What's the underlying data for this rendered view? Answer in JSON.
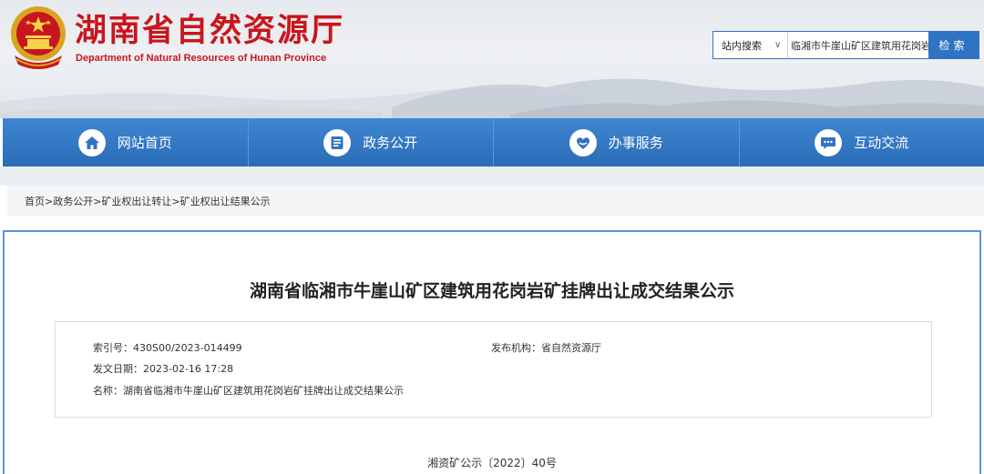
{
  "header": {
    "title": "湖南省自然资源厅",
    "subtitle": "Department of Natural Resources of Hunan Province",
    "emblem_icon": "national-emblem-icon",
    "brand_color": "#c7161d"
  },
  "search": {
    "scope_label": "站内搜索",
    "query_value": "临湘市牛崖山矿区建筑用花岗岩矿",
    "button_label": "检索",
    "accent_color": "#2f74c2"
  },
  "nav": {
    "items": [
      {
        "label": "网站首页",
        "icon": "home-icon"
      },
      {
        "label": "政务公开",
        "icon": "document-icon"
      },
      {
        "label": "办事服务",
        "icon": "service-icon"
      },
      {
        "label": "互动交流",
        "icon": "chat-icon"
      }
    ],
    "color": "#2a6cb8"
  },
  "breadcrumb": {
    "items": [
      "首页",
      "政务公开",
      "矿业权出让转让",
      "矿业权出让结果公示"
    ],
    "separator": ">"
  },
  "article": {
    "title": "湖南省临湘市牛崖山矿区建筑用花岗岩矿挂牌出让成交结果公示",
    "meta": {
      "index_label": "索引号：",
      "index_value": "430S00/2023-014499",
      "publisher_label": "发布机构：",
      "publisher_value": "省自然资源厅",
      "date_label": "发文日期：",
      "date_value": "2023-02-16 17:28",
      "name_label": "名称：",
      "name_value": "湖南省临湘市牛崖山矿区建筑用花岗岩矿挂牌出让成交结果公示"
    },
    "doc_number": "湘资矿公示〔2022〕40号"
  }
}
